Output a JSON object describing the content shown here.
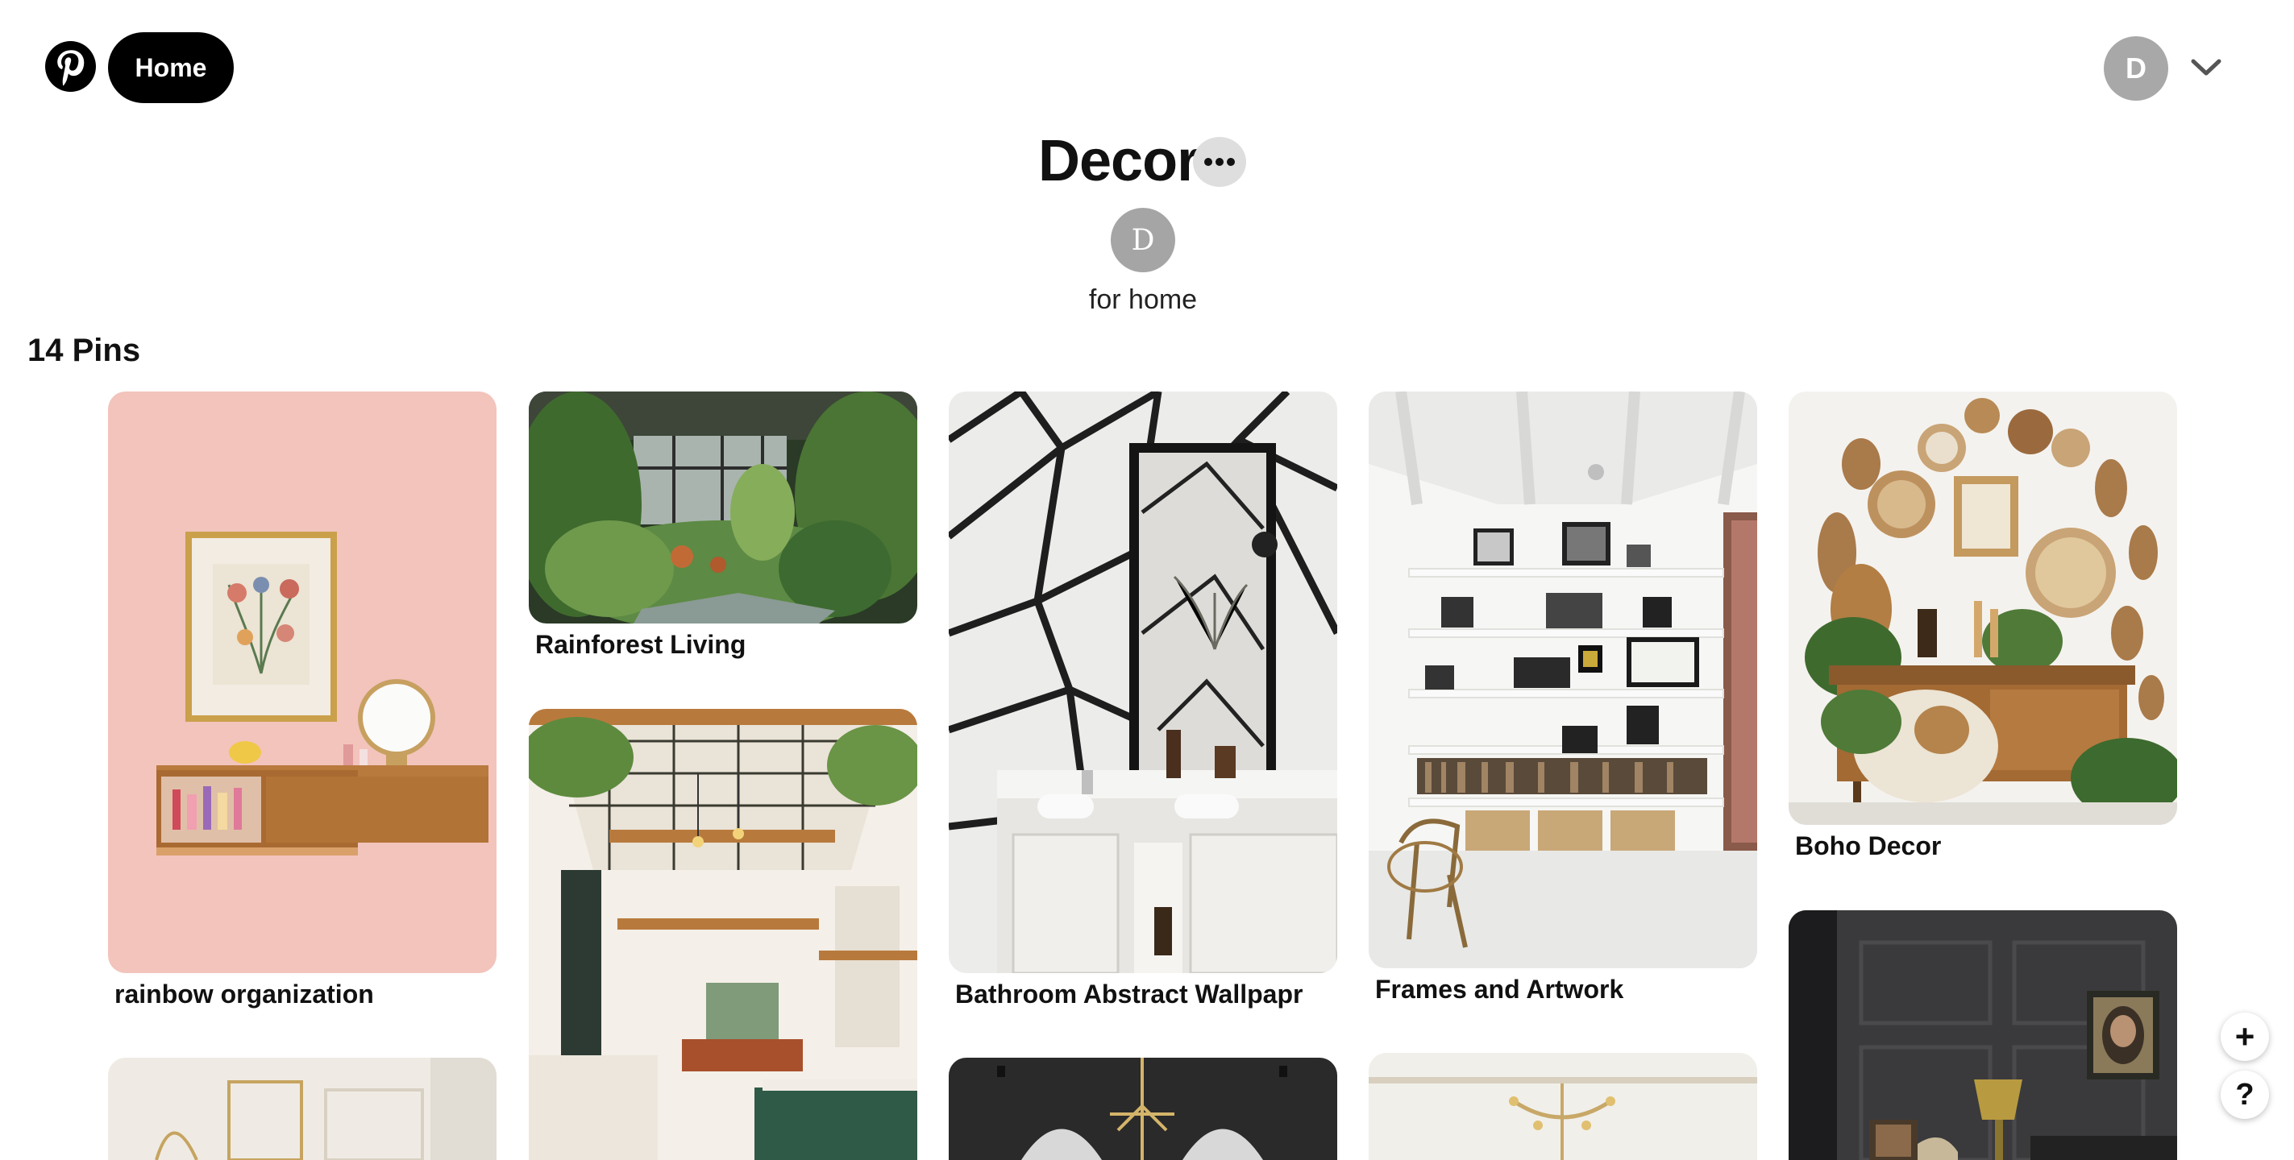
{
  "header": {
    "home_label": "Home",
    "user_initial": "D"
  },
  "board": {
    "title": "Decor",
    "owner_initial": "D",
    "description": "for home",
    "pin_count": "14 Pins"
  },
  "pins": [
    {
      "title": "rainbow organization"
    },
    {
      "title": "Rainforest Living"
    },
    {
      "title": "Bathroom Abstract Wallpapr"
    },
    {
      "title": "Frames and Artwork"
    },
    {
      "title": "Boho Decor"
    }
  ],
  "fab": {
    "add": "+",
    "help": "?"
  },
  "colors": {
    "brand": "#000000",
    "avatar_bg": "#a8a8a8",
    "more_bg": "#dedede"
  }
}
